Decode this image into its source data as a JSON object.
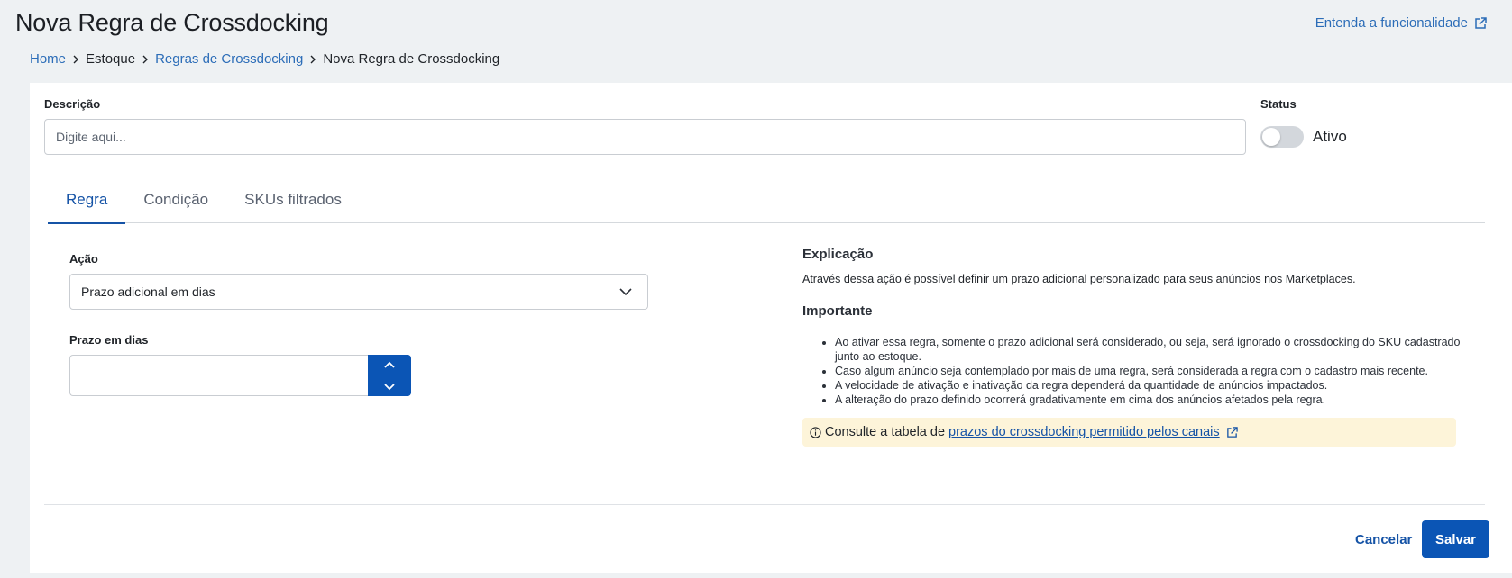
{
  "header": {
    "title": "Nova Regra de Crossdocking",
    "help_link": "Entenda a funcionalidade"
  },
  "breadcrumb": {
    "items": [
      "Home",
      "Estoque",
      "Regras de Crossdocking",
      "Nova Regra de Crossdocking"
    ]
  },
  "form": {
    "description_label": "Descrição",
    "description_placeholder": "Digite aqui...",
    "description_value": "",
    "status_label": "Status",
    "status_text": "Ativo",
    "status_on": false
  },
  "tabs": [
    {
      "label": "Regra",
      "active": true
    },
    {
      "label": "Condição",
      "active": false
    },
    {
      "label": "SKUs filtrados",
      "active": false
    }
  ],
  "rule": {
    "action_label": "Ação",
    "action_value": "Prazo adicional em dias",
    "days_label": "Prazo em dias",
    "days_value": ""
  },
  "explanation": {
    "title": "Explicação",
    "text": "Através dessa ação é possível definir um prazo adicional personalizado para seus anúncios nos Marketplaces.",
    "important_title": "Importante",
    "items": [
      "Ao ativar essa regra, somente o prazo adicional será considerado, ou seja, será ignorado o crossdocking do SKU cadastrado junto ao estoque.",
      "Caso algum anúncio seja contemplado por mais de uma regra, será considerada a regra com o cadastro mais recente.",
      "A velocidade de ativação e inativação da regra dependerá da quantidade de anúncios impactados.",
      "A alteração do prazo definido ocorrerá gradativamente em cima dos anúncios afetados pela regra."
    ],
    "notice_prefix": "Consulte a tabela de",
    "notice_link": "prazos do crossdocking permitido pelos canais"
  },
  "footer": {
    "cancel_label": "Cancelar",
    "save_label": "Salvar"
  },
  "colors": {
    "primary": "#0b55b5",
    "link": "#2c6db8",
    "notice_bg": "#fdf4d9",
    "page_bg": "#eef1f3"
  },
  "icons": {
    "help": "external-link-icon",
    "breadcrumb_sep": "chevron-right-icon",
    "select": "chevron-down-icon",
    "stepper_up": "chevron-up-icon",
    "stepper_down": "chevron-down-icon",
    "notice": "info-icon"
  }
}
